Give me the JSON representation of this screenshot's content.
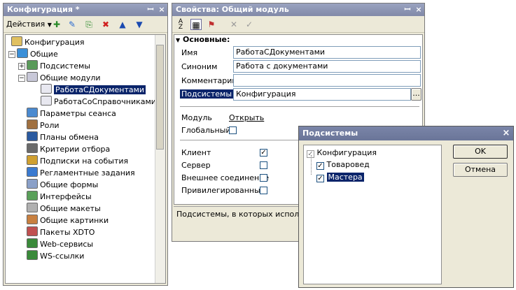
{
  "config_window": {
    "title": "Конфигурация *",
    "actions_label": "Действия",
    "tree": [
      {
        "label": "Конфигурация",
        "color": "#e0c060"
      },
      {
        "label": "Общие",
        "color": "#3a8fd8"
      },
      {
        "label": "Подсистемы",
        "color": "#5a9a5a"
      },
      {
        "label": "Общие модули",
        "color": "#c8c8d8"
      },
      {
        "label": "РаботаСДокументами",
        "color": "#e8e8f0"
      },
      {
        "label": "РаботаСоСправочниками",
        "color": "#e8e8f0"
      },
      {
        "label": "Параметры сеанса",
        "color": "#4a8ad0"
      },
      {
        "label": "Роли",
        "color": "#a07040"
      },
      {
        "label": "Планы обмена",
        "color": "#2a5aa0"
      },
      {
        "label": "Критерии отбора",
        "color": "#6a6a6a"
      },
      {
        "label": "Подписки на события",
        "color": "#d0a030"
      },
      {
        "label": "Регламентные задания",
        "color": "#3a7ad0"
      },
      {
        "label": "Общие формы",
        "color": "#8aa0c8"
      },
      {
        "label": "Интерфейсы",
        "color": "#5aa05a"
      },
      {
        "label": "Общие макеты",
        "color": "#b0b0b0"
      },
      {
        "label": "Общие картинки",
        "color": "#c88040"
      },
      {
        "label": "Пакеты XDTO",
        "color": "#c05050"
      },
      {
        "label": "Web-сервисы",
        "color": "#3a8a3a"
      },
      {
        "label": "WS-ссылки",
        "color": "#3a8a3a"
      }
    ]
  },
  "props_window": {
    "title": "Свойства: Общий модуль",
    "section_title": "Основные:",
    "fields": {
      "name_label": "Имя",
      "name_value": "РаботаСДокументами",
      "synonym_label": "Синоним",
      "synonym_value": "Работа с документами",
      "comment_label": "Комментарий",
      "comment_value": "",
      "subsystems_label": "Подсистемы",
      "subsystems_value": "Конфигурация",
      "ellipsis": "..."
    },
    "module_label": "Модуль",
    "module_link": "Открыть",
    "global_label": "Глобальный",
    "client_label": "Клиент",
    "server_label": "Сервер",
    "external_label": "Внешнее соединение",
    "privileged_label": "Привилегированный",
    "description": "Подсистемы, в которых используе",
    "checkbox_states": {
      "global": false,
      "client": true,
      "server": false,
      "external": false,
      "privileged": false
    }
  },
  "subsystems_dialog": {
    "title": "Подсистемы",
    "tree": [
      {
        "label": "Конфигурация",
        "checked": true
      },
      {
        "label": "Товаровед",
        "checked": true
      },
      {
        "label": "Мастера",
        "checked": true
      }
    ],
    "ok_label": "OK",
    "cancel_label": "Отмена"
  },
  "icons": [
    "pin-icon",
    "close-icon",
    "sort-az-icon",
    "categories-icon",
    "filter-icon",
    "delete-icon",
    "check-icon",
    "up-arrow-icon",
    "down-arrow-icon"
  ]
}
